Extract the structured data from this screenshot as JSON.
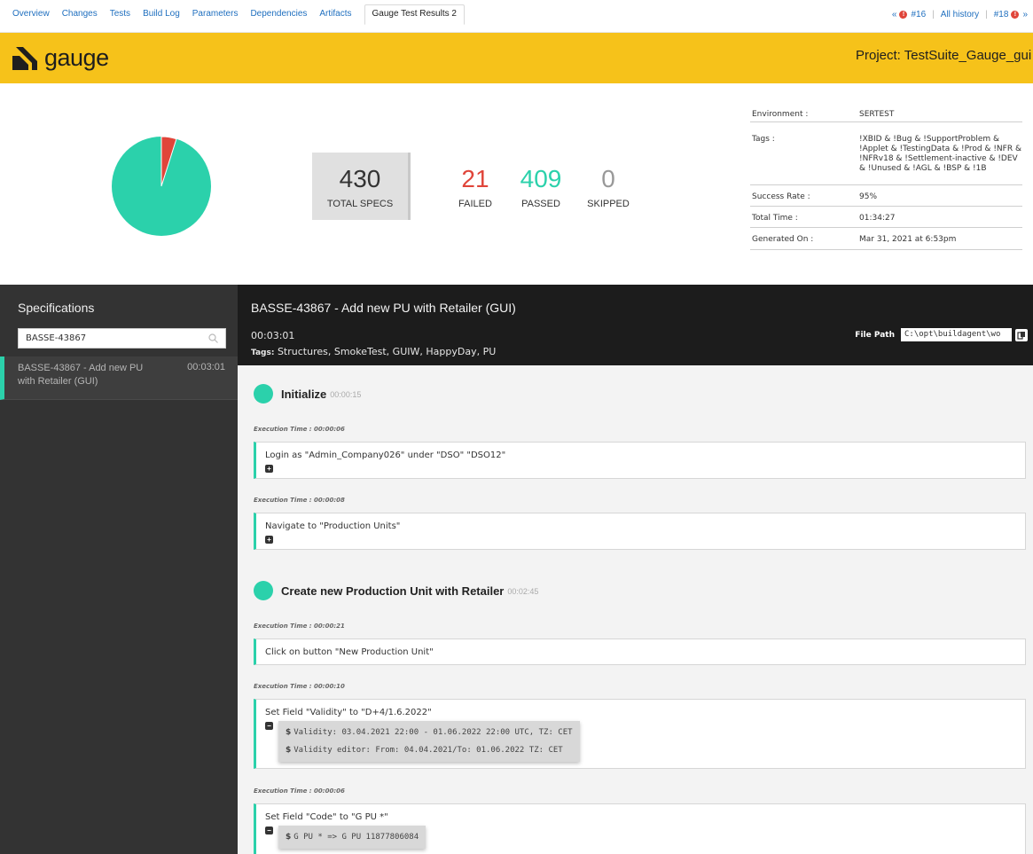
{
  "tabbar": {
    "tabs": [
      "Overview",
      "Changes",
      "Tests",
      "Build Log",
      "Parameters",
      "Dependencies",
      "Artifacts"
    ],
    "active_tab": "Gauge Test Results 2",
    "history": {
      "prev": "#16",
      "all": "All history",
      "next": "#18"
    }
  },
  "header": {
    "logo_text": "gauge",
    "project": "Project: TestSuite_Gauge_gui"
  },
  "stats": {
    "total": "430",
    "total_label": "TOTAL SPECS",
    "failed": "21",
    "failed_label": "FAILED",
    "passed": "409",
    "passed_label": "PASSED",
    "skipped": "0",
    "skipped_label": "SKIPPED",
    "colors": {
      "failed": "#e0453a",
      "passed": "#2bd1ab",
      "skipped": "#999999"
    },
    "pie_fractions": {
      "passed": 0.951,
      "failed": 0.049
    }
  },
  "environment": [
    {
      "key": "Environment :",
      "value": "SERTEST"
    },
    {
      "key": "Tags :",
      "value": "!XBID & !Bug & !SupportProblem & !Applet & !TestingData & !Prod & !NFR & !NFRv18 & !Settlement-inactive & !DEV & !Unused & !AGL & !BSP & !1B"
    },
    {
      "key": "Success Rate :",
      "value": "95%"
    },
    {
      "key": "Total Time :",
      "value": "01:34:27"
    },
    {
      "key": "Generated On :",
      "value": "Mar 31, 2021 at 6:53pm"
    }
  ],
  "sidebar": {
    "title": "Specifications",
    "search_value": "BASSE-43867",
    "items": [
      {
        "name": "BASSE-43867 - Add new PU with Retailer (GUI)",
        "time": "00:03:01"
      }
    ]
  },
  "spec": {
    "title": "BASSE-43867 - Add new PU with Retailer (GUI)",
    "duration": "00:03:01",
    "tags_label": "Tags:",
    "tags": "Structures, SmokeTest, GUIW, HappyDay, PU",
    "file_path_label": "File Path",
    "file_path": "C:\\opt\\buildagent\\wo"
  },
  "scenarios": [
    {
      "name": "Initialize",
      "time": "00:00:15"
    },
    {
      "name": "Create new Production Unit with Retailer",
      "time": "00:02:45"
    }
  ],
  "steps": [
    {
      "exec": "Execution Time : 00:00:06",
      "text": "Login as \"Admin_Company026\" under \"DSO\" \"DSO12\"",
      "toggle": "+"
    },
    {
      "exec": "Execution Time : 00:00:08",
      "text": "Navigate to \"Production Units\"",
      "toggle": "+"
    },
    {
      "exec": "Execution Time : 00:00:21",
      "text": "Click on button \"New Production Unit\""
    },
    {
      "exec": "Execution Time : 00:00:10",
      "text": "Set Field \"Validity\" to \"D+4/1.6.2022\"",
      "toggle": "−",
      "messages": [
        "Validity: 03.04.2021 22:00 - 01.06.2022 22:00 UTC, TZ: CET",
        "Validity editor: From: 04.04.2021/To: 01.06.2022 TZ: CET"
      ]
    },
    {
      "exec": "Execution Time : 00:00:06",
      "text": "Set Field \"Code\" to \"G PU *\"",
      "toggle": "−",
      "messages": [
        "G PU * => G PU 11877806084"
      ]
    }
  ]
}
